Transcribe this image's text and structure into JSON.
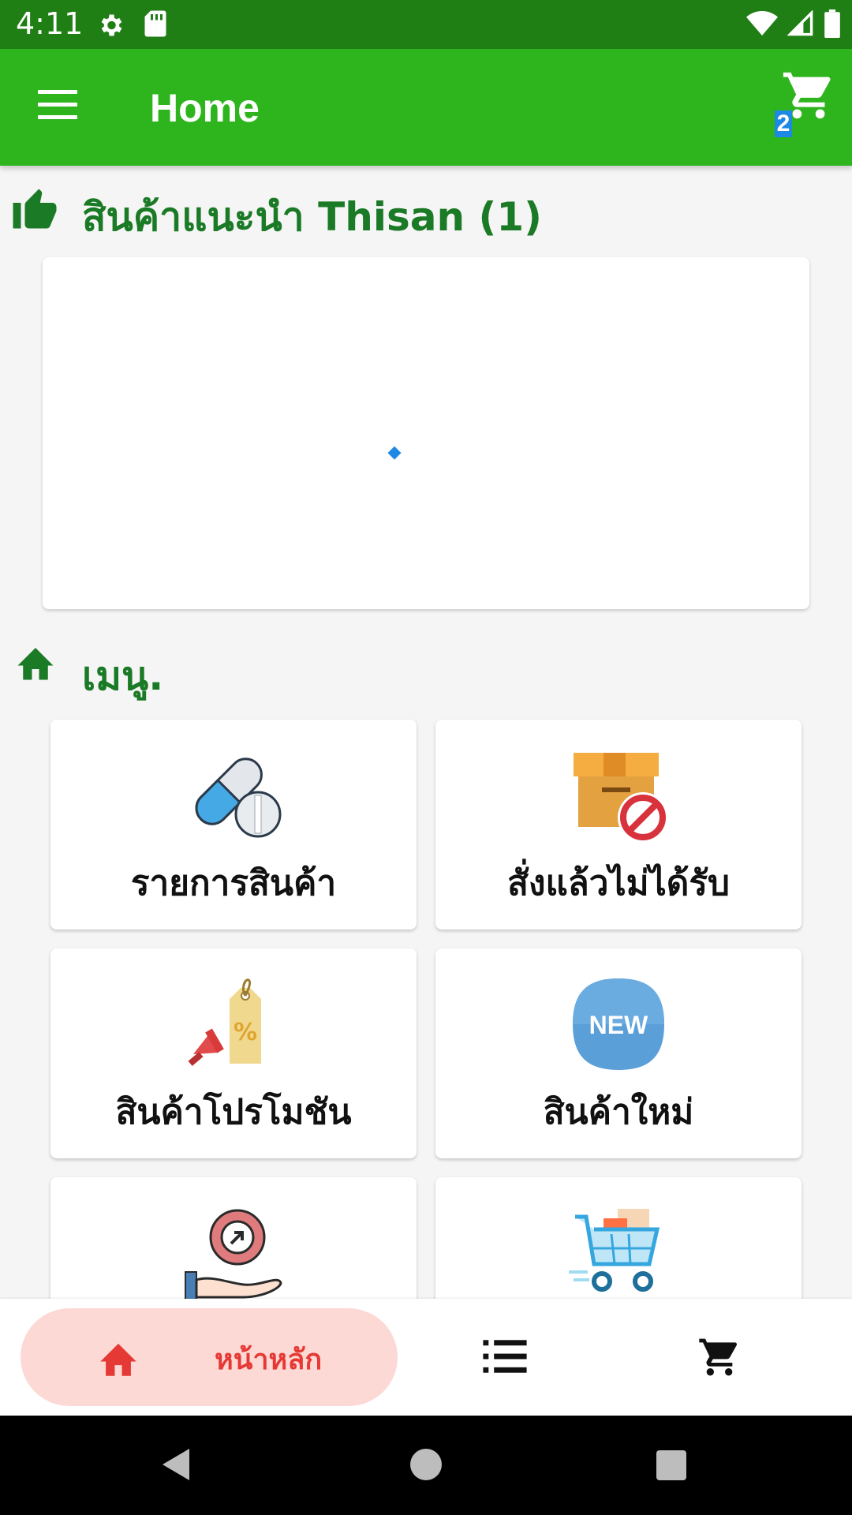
{
  "status_bar": {
    "time": "4:11"
  },
  "app_bar": {
    "title": "Home",
    "cart_count": "2"
  },
  "recommended": {
    "title": "สินค้าแนะนำ Thisan (1)"
  },
  "menu_section": {
    "title": "เมนู.",
    "items": [
      {
        "label": "รายการสินค้า",
        "icon": "pill-capsule-icon"
      },
      {
        "label": "สั่งแล้วไม่ได้รับ",
        "icon": "box-blocked-icon"
      },
      {
        "label": "สินค้าโปรโมชัน",
        "icon": "promotion-tag-icon"
      },
      {
        "label": "สินค้าใหม่",
        "icon": "new-badge-icon",
        "badge_text": "NEW"
      },
      {
        "label": "",
        "icon": "hand-send-icon"
      },
      {
        "label": "",
        "icon": "shopping-cart-boxes-icon"
      }
    ]
  },
  "bottom_nav": {
    "home_label": "หน้าหลัก"
  },
  "colors": {
    "status_bar": "#1f7f15",
    "app_bar": "#2eb51d",
    "section_title": "#1b7a26",
    "home_pill": "#fdd9d6",
    "home_active": "#e53935",
    "badge": "#1e88e5"
  }
}
